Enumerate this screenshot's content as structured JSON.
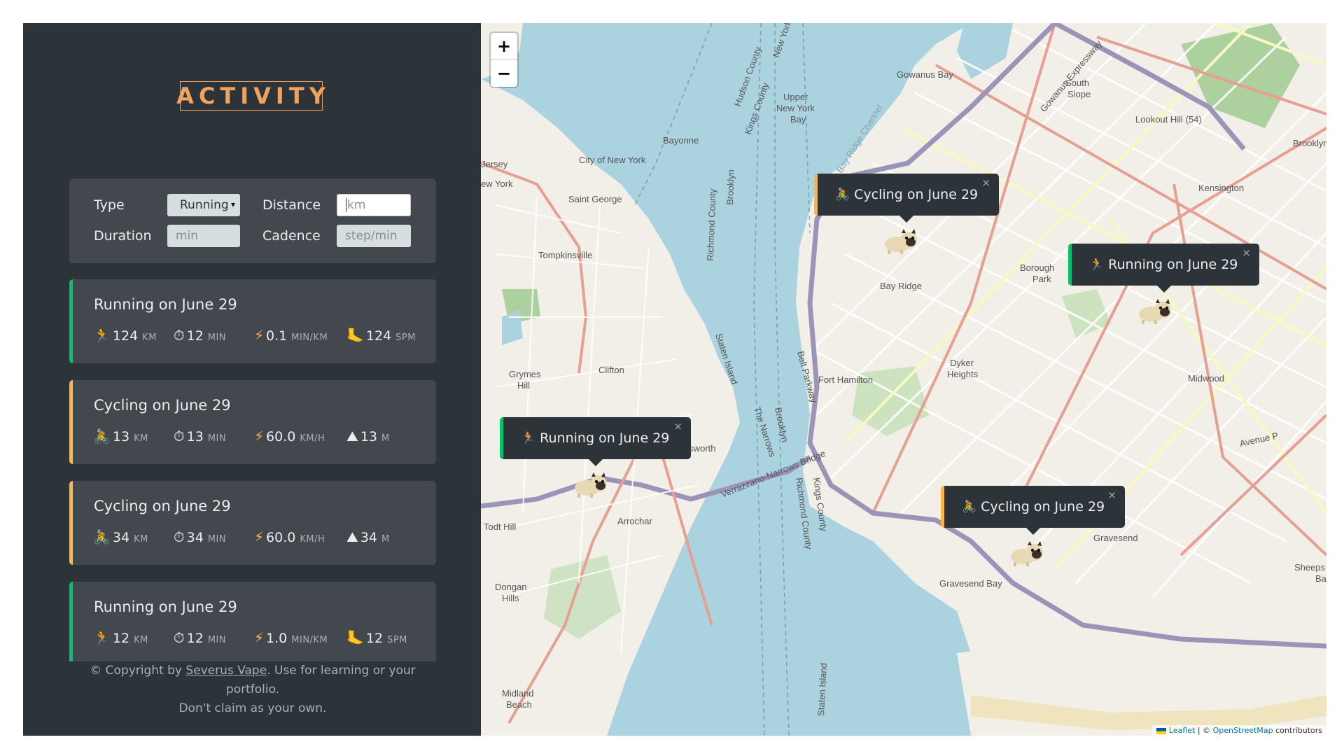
{
  "sidebar": {
    "logo_text": "ACTIVITY",
    "form": {
      "type_label": "Type",
      "type_value": "Running",
      "distance_label": "Distance",
      "distance_placeholder": "km",
      "duration_label": "Duration",
      "duration_placeholder": "min",
      "cadence_label": "Cadence",
      "cadence_placeholder": "step/min"
    },
    "workouts": [
      {
        "kind": "running",
        "title": "Running on June 29",
        "stats": [
          {
            "icon": "🏃",
            "value": "124",
            "unit": "KM"
          },
          {
            "icon": "⏱",
            "value": "12",
            "unit": "MIN"
          },
          {
            "icon": "⚡",
            "value": "0.1",
            "unit": "MIN/KM"
          },
          {
            "icon": "🦶",
            "value": "124",
            "unit": "SPM"
          }
        ]
      },
      {
        "kind": "cycling",
        "title": "Cycling on June 29",
        "stats": [
          {
            "icon": "🚴",
            "value": "13",
            "unit": "KM"
          },
          {
            "icon": "⏱",
            "value": "13",
            "unit": "MIN"
          },
          {
            "icon": "⚡",
            "value": "60.0",
            "unit": "KM/H"
          },
          {
            "icon": "⛰",
            "value": "13",
            "unit": "M"
          }
        ]
      },
      {
        "kind": "cycling",
        "title": "Cycling on June 29",
        "stats": [
          {
            "icon": "🚴",
            "value": "34",
            "unit": "KM"
          },
          {
            "icon": "⏱",
            "value": "34",
            "unit": "MIN"
          },
          {
            "icon": "⚡",
            "value": "60.0",
            "unit": "KM/H"
          },
          {
            "icon": "⛰",
            "value": "34",
            "unit": "M"
          }
        ]
      },
      {
        "kind": "running",
        "title": "Running on June 29",
        "stats": [
          {
            "icon": "🏃",
            "value": "12",
            "unit": "KM"
          },
          {
            "icon": "⏱",
            "value": "12",
            "unit": "MIN"
          },
          {
            "icon": "⚡",
            "value": "1.0",
            "unit": "MIN/KM"
          },
          {
            "icon": "🦶",
            "value": "12",
            "unit": "SPM"
          }
        ]
      }
    ],
    "copyright_pre": "© Copyright by ",
    "copyright_link": "Severus Vape",
    "copyright_post": ". Use for learning or your portfolio.",
    "copyright_line2": "Don't claim as your own."
  },
  "map": {
    "zoom_in": "+",
    "zoom_out": "−",
    "popups": [
      {
        "kind": "cycling",
        "icon": "🚴",
        "text": "Cycling on June 29",
        "close": "×"
      },
      {
        "kind": "running",
        "icon": "🏃",
        "text": "Running on June 29",
        "close": "×"
      },
      {
        "kind": "running",
        "icon": "🏃",
        "text": "Running on June 29",
        "close": "×"
      },
      {
        "kind": "cycling",
        "icon": "🚴",
        "text": "Cycling on June 29",
        "close": "×"
      }
    ],
    "labels": {
      "gowanus_bay": "Gowanus Bay",
      "gowanus_expwy": "Gowanus Expressway",
      "south_slope": "South",
      "south_slope2": "Slope",
      "lookout_hill": "Lookout Hill (54)",
      "brooklyn": "Brooklyn",
      "kensington": "Kensington",
      "borough_park": "Borough",
      "borough_park2": "Park",
      "bay_ridge": "Bay Ridge",
      "dyker": "Dyker",
      "dyker2": "Heights",
      "fort_hamilton": "Fort Hamilton",
      "midwood": "Midwood",
      "avenue_p": "Avenue P",
      "gravesend": "Gravesend",
      "gravesend_bay": "Gravesend Bay",
      "sheeps": "Sheeps",
      "sheeps2": "Ba",
      "upper_ny_bay": "Upper",
      "upper_ny_bay2": "New York",
      "upper_ny_bay3": "Bay",
      "bayonne": "Bayonne",
      "city_ny": "City of New York",
      "jersey": "Jersey",
      "new_york": "ew York",
      "saint_george": "Saint George",
      "tompkinsville": "Tompkinsville",
      "grymes": "Grymes",
      "grymes2": "Hill",
      "clifton": "Clifton",
      "todt_hill": "Todt Hill",
      "arrochar": "Arrochar",
      "dongan": "Dongan",
      "dongan2": "Hills",
      "midland": "Midland",
      "midland2": "Beach",
      "verrazzano": "Verrazzano-Narrows Bridge",
      "belt_parkway": "Belt Parkway",
      "staten_island": "Staten Island",
      "staten_island2": "Staten Island",
      "the_narrows": "The Narrows",
      "brooklyn_v": "Brooklyn",
      "richmond_county": "Richmond County",
      "kings_county": "Kings County",
      "hudson_county": "Hudson County",
      "kings_county2": "Kings County",
      "new_york_v": "New York",
      "richmond_county2": "Richmond County",
      "brooklyn_v2": "Brooklyn",
      "kings_county3": "Kings County",
      "dsworth": "dsworth",
      "bay_ridge_ch": "Bay Ridge Channel"
    },
    "attribution_leaflet": "Leaflet",
    "attribution_mid": " | © ",
    "attribution_osm": "OpenStreetMap",
    "attribution_post": " contributors"
  },
  "colors": {
    "running": "#00c46a",
    "cycling": "#ffb545",
    "sidebar_bg": "#2d3439",
    "card_bg": "#42484d",
    "logo": "#f0a35e",
    "water": "#aad3df",
    "land": "#f2efe9"
  }
}
